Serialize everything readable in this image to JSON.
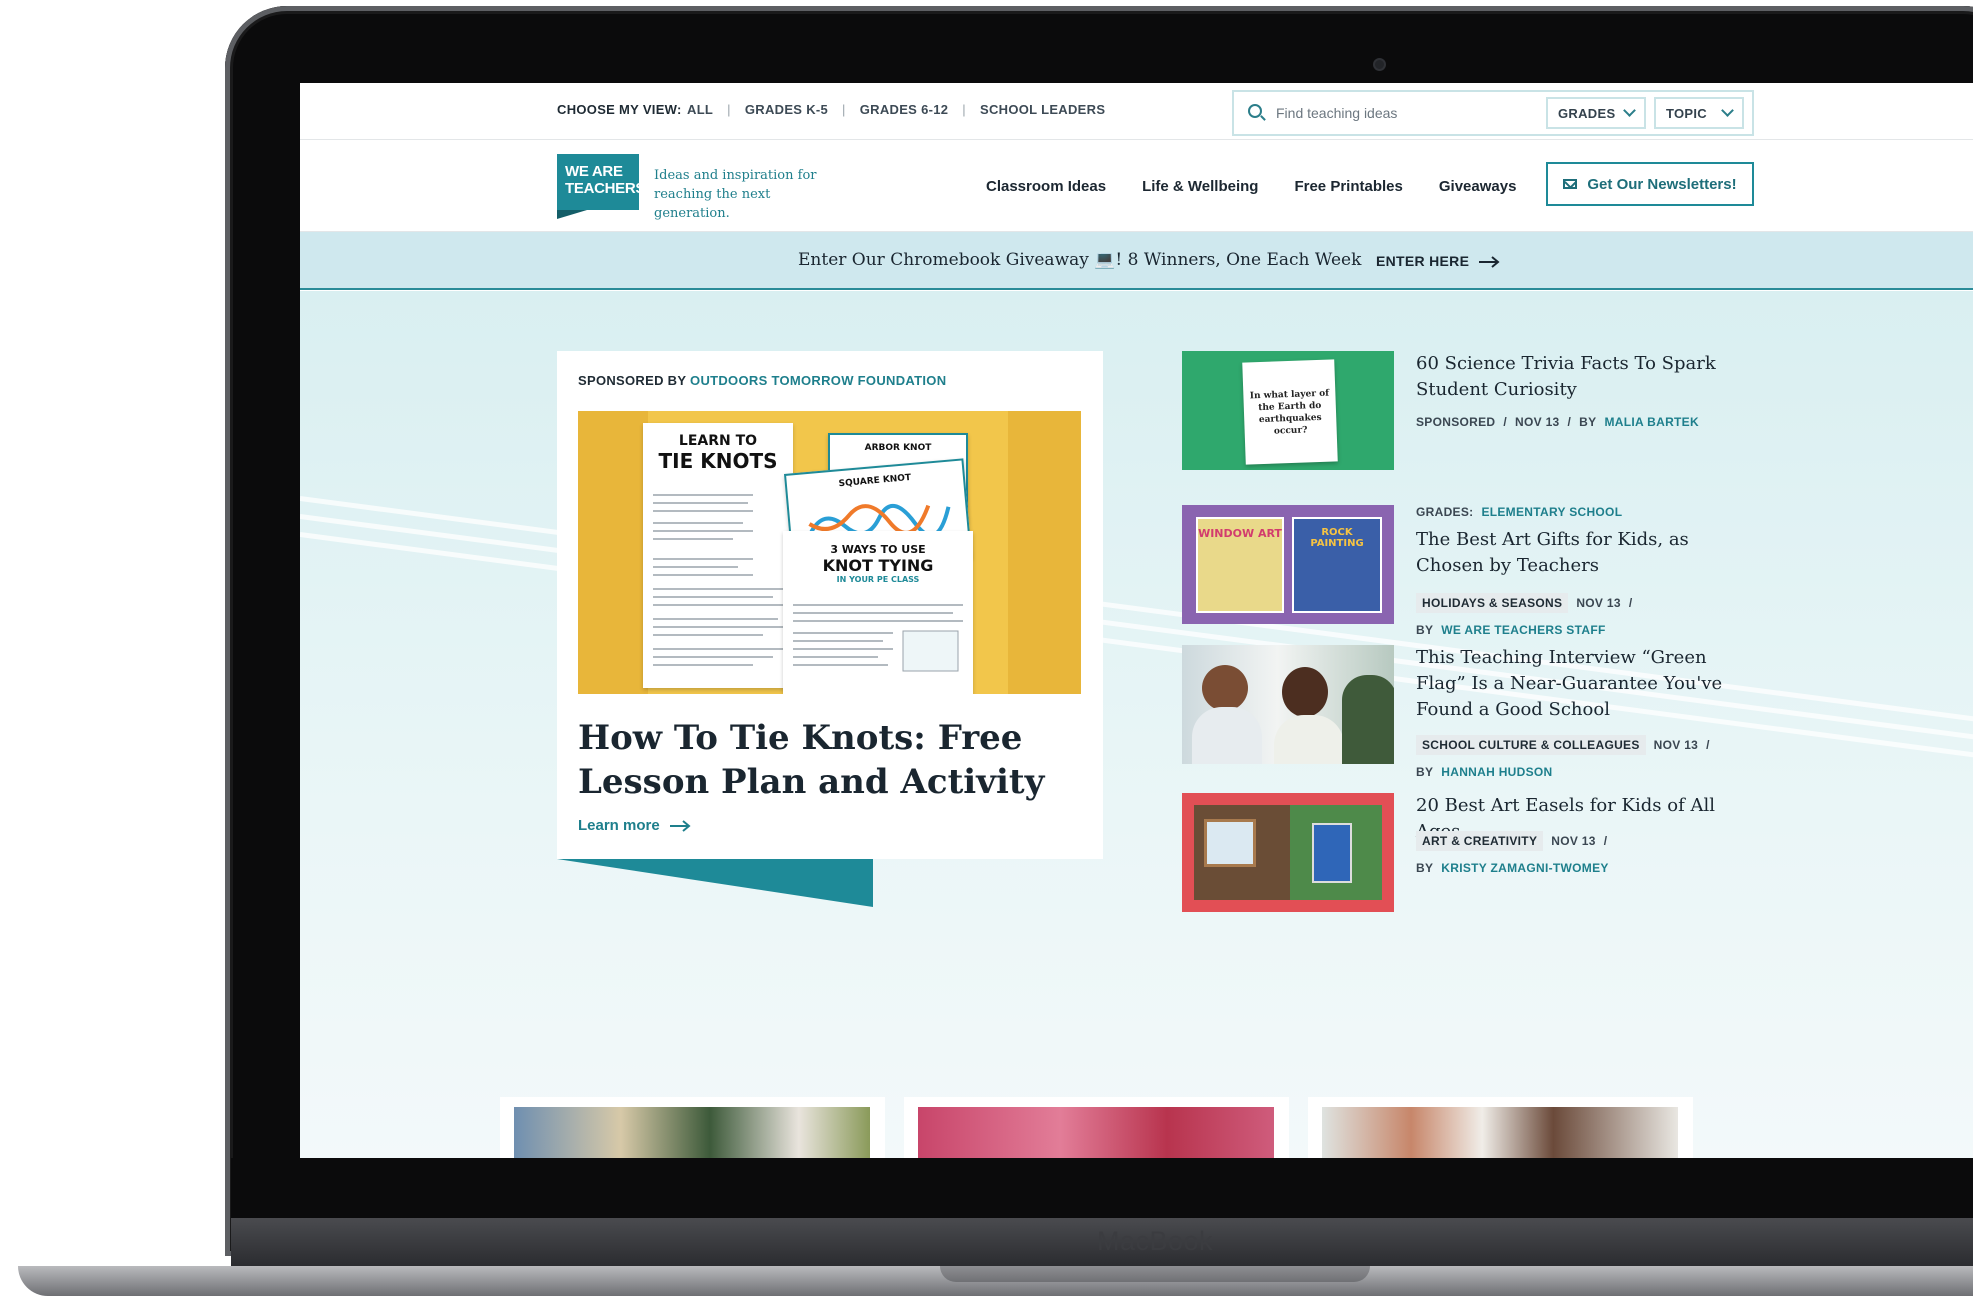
{
  "device": {
    "brand_label": "MacBook"
  },
  "topbar": {
    "view_label": "CHOOSE MY VIEW:",
    "views": [
      "ALL",
      "GRADES K-5",
      "GRADES 6-12",
      "SCHOOL LEADERS"
    ],
    "search_placeholder": "Find teaching ideas",
    "grades_dropdown": "GRADES",
    "topic_dropdown": "TOPIC"
  },
  "header": {
    "logo_line1": "WE ARE",
    "logo_line2": "TEACHERS",
    "tagline": "Ideas and inspiration for reaching the next generation.",
    "nav": [
      "Classroom Ideas",
      "Life & Wellbeing",
      "Free Printables",
      "Giveaways"
    ],
    "newsletter_button": "Get Our Newsletters!"
  },
  "promo": {
    "text": "Enter Our Chromebook Giveaway 💻! 8 Winners, One Each Week",
    "link": "ENTER HERE"
  },
  "feature": {
    "sponsored_prefix": "SPONSORED BY",
    "sponsor": "OUTDOORS TOMORROW FOUNDATION",
    "image_text": {
      "sheet1_title_a": "LEARN TO",
      "sheet1_title_b": "TIE KNOTS",
      "sheet2_title": "ARBOR KNOT",
      "sheet3_title": "SQUARE KNOT",
      "sheet4_title_a": "3 WAYS TO USE",
      "sheet4_title_b": "KNOT TYING",
      "sheet4_sub": "IN YOUR PE CLASS"
    },
    "title": "How To Tie Knots: Free Lesson Plan and Activity",
    "cta": "Learn more"
  },
  "articles": [
    {
      "thumb_text": "In what layer of the Earth do earthquakes occur?",
      "title": "60 Science Trivia Facts To Spark Student Curiosity",
      "label": "SPONSORED",
      "date": "NOV 13",
      "by": "BY",
      "author": "MALIA BARTEK"
    },
    {
      "grades_label": "GRADES:",
      "grades_value": "ELEMENTARY SCHOOL",
      "thumb_text_a": "WINDOW ART",
      "thumb_text_b": "ROCK PAINTING",
      "title": "The Best Art Gifts for Kids, as Chosen by Teachers",
      "tag": "HOLIDAYS & SEASONS",
      "date": "NOV 13",
      "by": "BY",
      "author": "WE ARE TEACHERS STAFF"
    },
    {
      "title": "This Teaching Interview “Green Flag” Is a Near-Guarantee You've Found a Good School",
      "tag": "SCHOOL CULTURE & COLLEAGUES",
      "date": "NOV 13",
      "by": "BY",
      "author": "HANNAH HUDSON"
    },
    {
      "title": "20 Best Art Easels for Kids of All Ages",
      "tag": "ART & CREATIVITY",
      "date": "NOV 13",
      "by": "BY",
      "author": "KRISTY ZAMAGNI-TWOMEY"
    }
  ],
  "colors": {
    "accent": "#1e8a98",
    "promo_bg": "#cfe8ee",
    "text_dark": "#1a2630"
  }
}
